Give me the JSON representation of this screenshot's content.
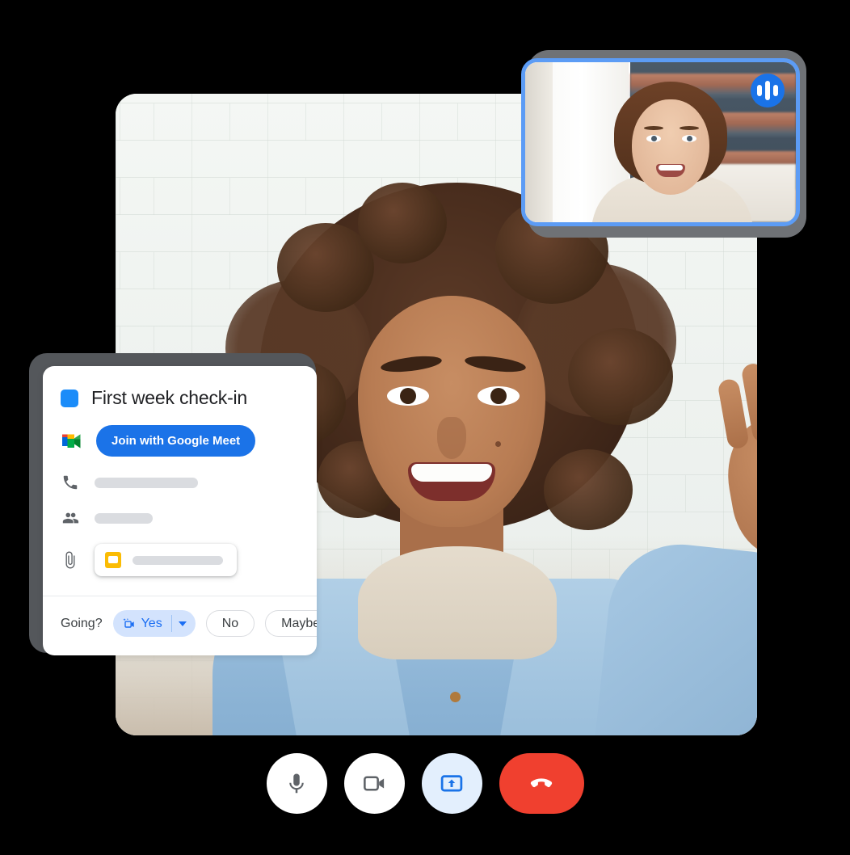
{
  "app": {
    "name": "Google Meet video call",
    "accent_blue": "#1a73e8",
    "light_blue": "#d3e3fd",
    "danger_red": "#f0402f"
  },
  "main_video": {
    "label": "main-speaker-video",
    "description": "Smiling woman with curly hair waving, white brick wall background"
  },
  "thumbnail": {
    "label": "self-view-thumbnail",
    "description": "Woman in front of bookshelf, active speaker",
    "border_color": "#5c9cf5",
    "speaking_indicator": "audio-wave-icon"
  },
  "calendar_card": {
    "title": "First week check-in",
    "color_chip": "#1b8cf9",
    "meet_icon": "google-meet-icon",
    "join_button": "Join with Google Meet",
    "rows": [
      {
        "icon": "phone-icon",
        "value": ""
      },
      {
        "icon": "guests-icon",
        "value": ""
      },
      {
        "icon": "attachment-icon",
        "value": "",
        "file_icon": "google-slides-icon"
      }
    ],
    "footer": {
      "going_label": "Going?",
      "yes_label": "Yes",
      "yes_icon": "join-video-sparkle-icon",
      "yes_caret": "chevron-down-icon",
      "no_label": "No",
      "maybe_label": "Maybe"
    }
  },
  "controls": [
    {
      "name": "microphone-button",
      "icon": "microphone-icon",
      "state": "on"
    },
    {
      "name": "camera-button",
      "icon": "video-camera-icon",
      "state": "on"
    },
    {
      "name": "present-button",
      "icon": "present-screen-icon",
      "state": "active"
    },
    {
      "name": "end-call-button",
      "icon": "end-call-icon",
      "state": "default"
    }
  ]
}
